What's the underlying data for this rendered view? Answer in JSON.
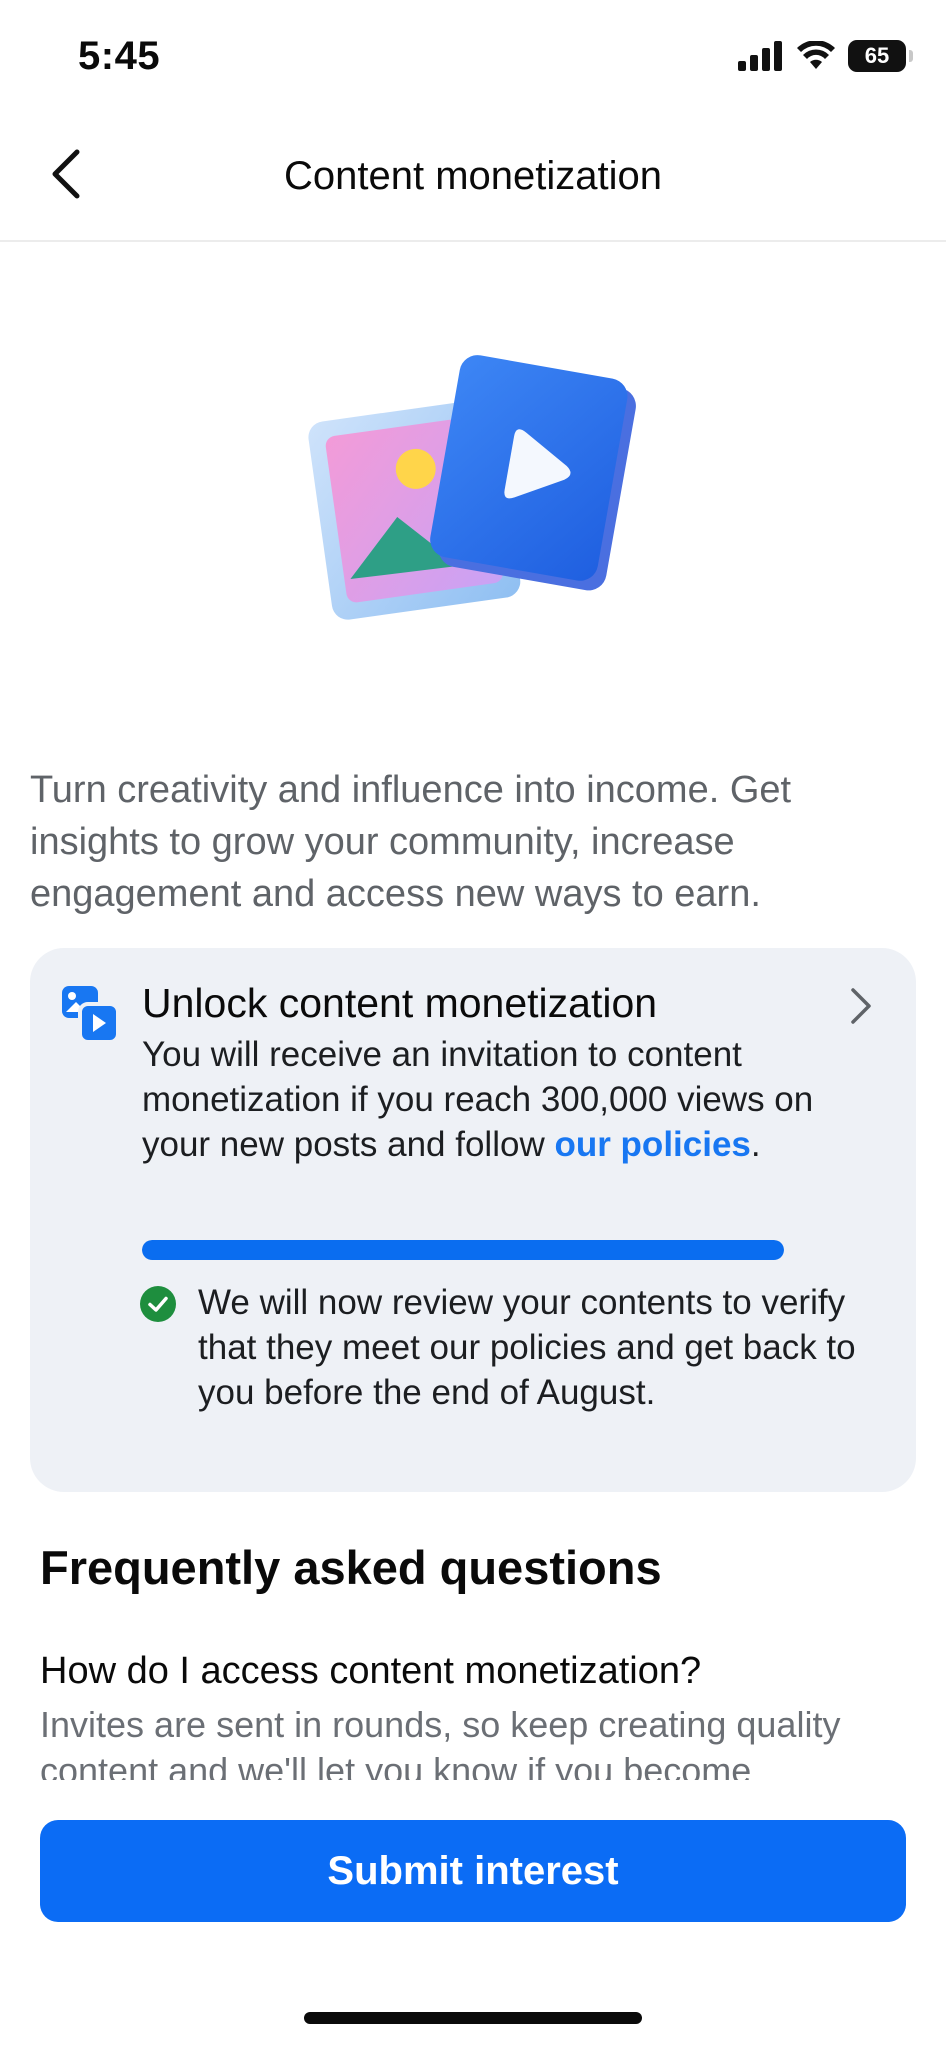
{
  "status_bar": {
    "time": "5:45",
    "battery": "65",
    "icons": [
      "signal-icon",
      "wifi-icon",
      "battery-icon"
    ]
  },
  "nav": {
    "title": "Content monetization",
    "back_icon": "chevron-left-icon"
  },
  "hero": {
    "icon": "photo-video-illustration"
  },
  "intro": {
    "text": "Turn creativity and influence into income. Get insights to grow your community, increase engagement and access new ways to earn."
  },
  "card": {
    "icon": "monetization-media-icon",
    "title": "Unlock content monetization",
    "description": "You will receive an invitation to content monetization if you reach 300,000 views on your new posts and follow ",
    "policies_link": "our policies",
    "description_end": ".",
    "progress_fraction": 1.0,
    "review_icon": "check-circle-icon",
    "review_text": "We will now review your contents to verify that they meet our policies and get back to you before the end of August."
  },
  "faq": {
    "heading": "Frequently asked questions",
    "question": "How do I access content monetization?",
    "answer": "Invites are sent in rounds, so keep creating quality content and we'll let you know if you become"
  },
  "actions": {
    "submit_label": "Submit interest"
  },
  "colors": {
    "accent": "#0b6cf5",
    "card_bg": "#eef1f6",
    "success": "#1e8e3e"
  }
}
